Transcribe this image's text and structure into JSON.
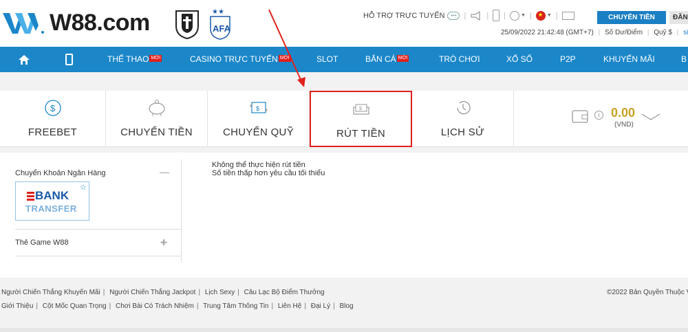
{
  "header": {
    "brand": "W88.com",
    "support_label": "HỖ TRỢ TRỰC TUYẾN",
    "transfer_button": "CHUYỂN TIỀN",
    "login_button": "ĐĂN",
    "datetime": "25/09/2022 21:42:48 (GMT+7)",
    "balance_label": "Số Dư/Điểm",
    "fund_label": "Quỹ $",
    "username": "sieu",
    "accent_color": "#1b87c9"
  },
  "nav": {
    "items": [
      {
        "label": "THỂ THAO",
        "badge": "MỚI"
      },
      {
        "label": "CASINO TRỰC TUYẾN",
        "badge": "MỚI"
      },
      {
        "label": "SLOT",
        "badge": ""
      },
      {
        "label": "BẮN CÁ",
        "badge": "MỚI"
      },
      {
        "label": "TRÒ CHƠI",
        "badge": ""
      },
      {
        "label": "XỔ SỐ",
        "badge": ""
      },
      {
        "label": "P2P",
        "badge": ""
      },
      {
        "label": "KHUYẾN MÃI",
        "badge": ""
      },
      {
        "label": "B",
        "badge": ""
      }
    ]
  },
  "tabs": {
    "items": [
      {
        "label": "FREEBET",
        "icon": "dollar-circle-icon"
      },
      {
        "label": "CHUYỂN TIỀN",
        "icon": "piggy-bank-icon"
      },
      {
        "label": "CHUYỂN QUỸ",
        "icon": "transfer-fund-icon"
      },
      {
        "label": "RÚT TIỀN",
        "icon": "withdraw-cash-icon",
        "active": true
      },
      {
        "label": "LỊCH SỬ",
        "icon": "history-clock-icon"
      }
    ],
    "wallet_amount": "0.00",
    "wallet_currency": "(VND)"
  },
  "withdraw": {
    "method_header": "Chuyển Khoản Ngân Hàng",
    "bank_card_line1": "BANK",
    "bank_card_line2": "TRANSFER",
    "game_card_label": "Thẻ Game W88",
    "message_line1": "Không thể thực hiện rút tiền",
    "message_line2": "Số tiền thấp hơn yêu cầu tối thiểu"
  },
  "footer": {
    "links_row1": [
      "Người Chiến Thắng Khuyến Mãi",
      "Người Chiến Thắng Jackpot",
      "Lịch Sexy",
      "Câu Lạc Bộ Điểm Thưởng"
    ],
    "links_row2": [
      "Giới Thiệu",
      "Cột Mốc Quan Trọng",
      "Chơi Bài Có Trách Nhiệm",
      "Trung Tâm Thông Tin",
      "Liên Hệ",
      "Đại Lý",
      "Blog"
    ],
    "copyright": "©2022 Bản Quyền Thuộc V"
  }
}
